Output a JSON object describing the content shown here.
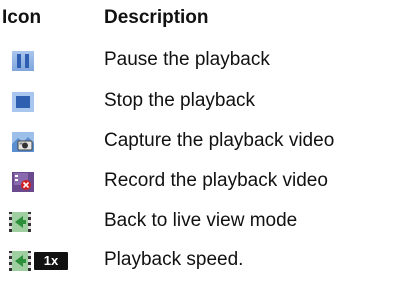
{
  "header": {
    "icon_col": "Icon",
    "desc_col": "Description"
  },
  "rows": [
    {
      "icon": "pause-icon",
      "description": "Pause the playback"
    },
    {
      "icon": "stop-icon",
      "description": "Stop the playback"
    },
    {
      "icon": "camera-capture-icon",
      "description": "Capture the playback video"
    },
    {
      "icon": "record-video-icon",
      "description": "Record the playback video"
    },
    {
      "icon": "live-view-icon",
      "description": "Back to live view mode"
    },
    {
      "icon": "playback-speed-icon",
      "description": "Playback speed.",
      "badge": "1x"
    }
  ],
  "colors": {
    "icon_blue": "#3b6cc0",
    "icon_light_blue": "#9fc0ea",
    "record_red": "#d22020",
    "live_green": "#3aa84a"
  }
}
